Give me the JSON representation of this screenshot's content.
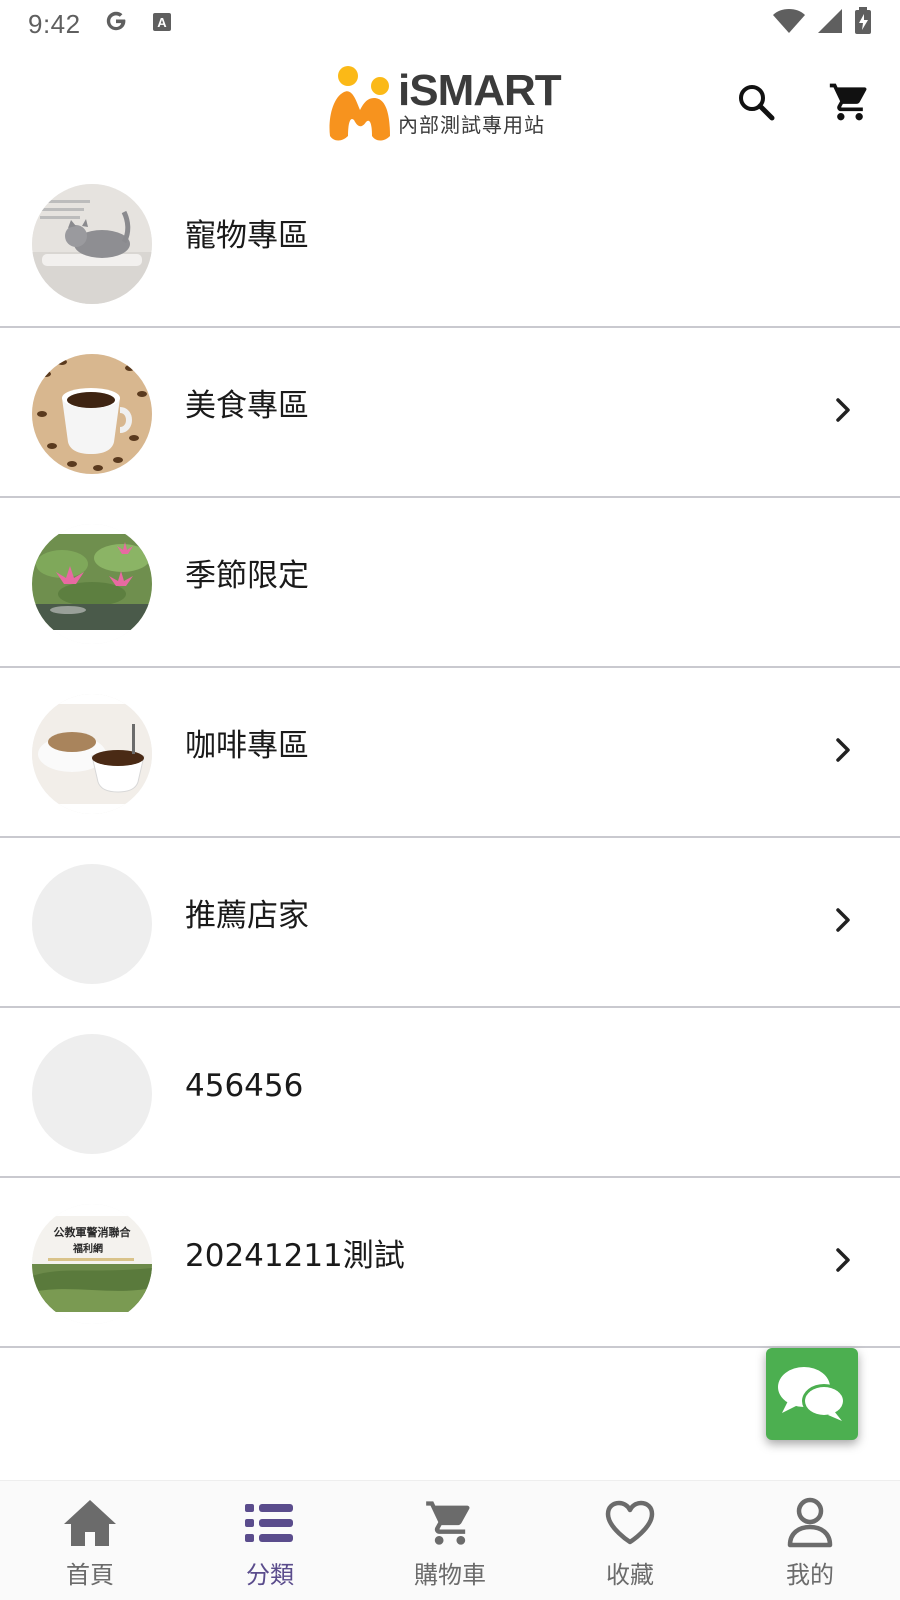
{
  "status_bar": {
    "time": "9:42",
    "icons": [
      "google-g-icon",
      "text-a-icon",
      "wifi-icon",
      "signal-icon",
      "battery-charging-icon"
    ]
  },
  "header": {
    "logo_word": "iSMART",
    "logo_subtitle": "內部測試專用站",
    "icons": [
      "search-icon",
      "cart-icon"
    ]
  },
  "categories": [
    {
      "label": "寵物專區",
      "has_chevron": false,
      "thumb": "cat-photo"
    },
    {
      "label": "美食專區",
      "has_chevron": true,
      "thumb": "coffee-beans-photo"
    },
    {
      "label": "季節限定",
      "has_chevron": false,
      "thumb": "lotus-photo"
    },
    {
      "label": "咖啡專區",
      "has_chevron": true,
      "thumb": "pour-over-coffee-photo"
    },
    {
      "label": "推薦店家",
      "has_chevron": true,
      "thumb": "empty"
    },
    {
      "label": "456456",
      "has_chevron": false,
      "thumb": "empty"
    },
    {
      "label": "20241211測試",
      "has_chevron": true,
      "thumb": "banner-landscape-photo"
    }
  ],
  "banner_thumb_text": {
    "line1": "公教軍警消聯合",
    "line2": "福利網"
  },
  "chat_fab": {
    "icon": "chat-bubbles-icon"
  },
  "bottom_nav": {
    "items": [
      {
        "label": "首頁",
        "icon": "home-icon",
        "active": false
      },
      {
        "label": "分類",
        "icon": "list-icon",
        "active": true
      },
      {
        "label": "購物車",
        "icon": "cart-icon",
        "active": false
      },
      {
        "label": "收藏",
        "icon": "heart-icon",
        "active": false
      },
      {
        "label": "我的",
        "icon": "user-icon",
        "active": false
      }
    ]
  },
  "colors": {
    "accent": "#5a4c8c",
    "logo_orange": "#f7931e",
    "logo_yellow": "#fbb917",
    "fab_green": "#4caf50",
    "divider": "#c9c9cf"
  }
}
